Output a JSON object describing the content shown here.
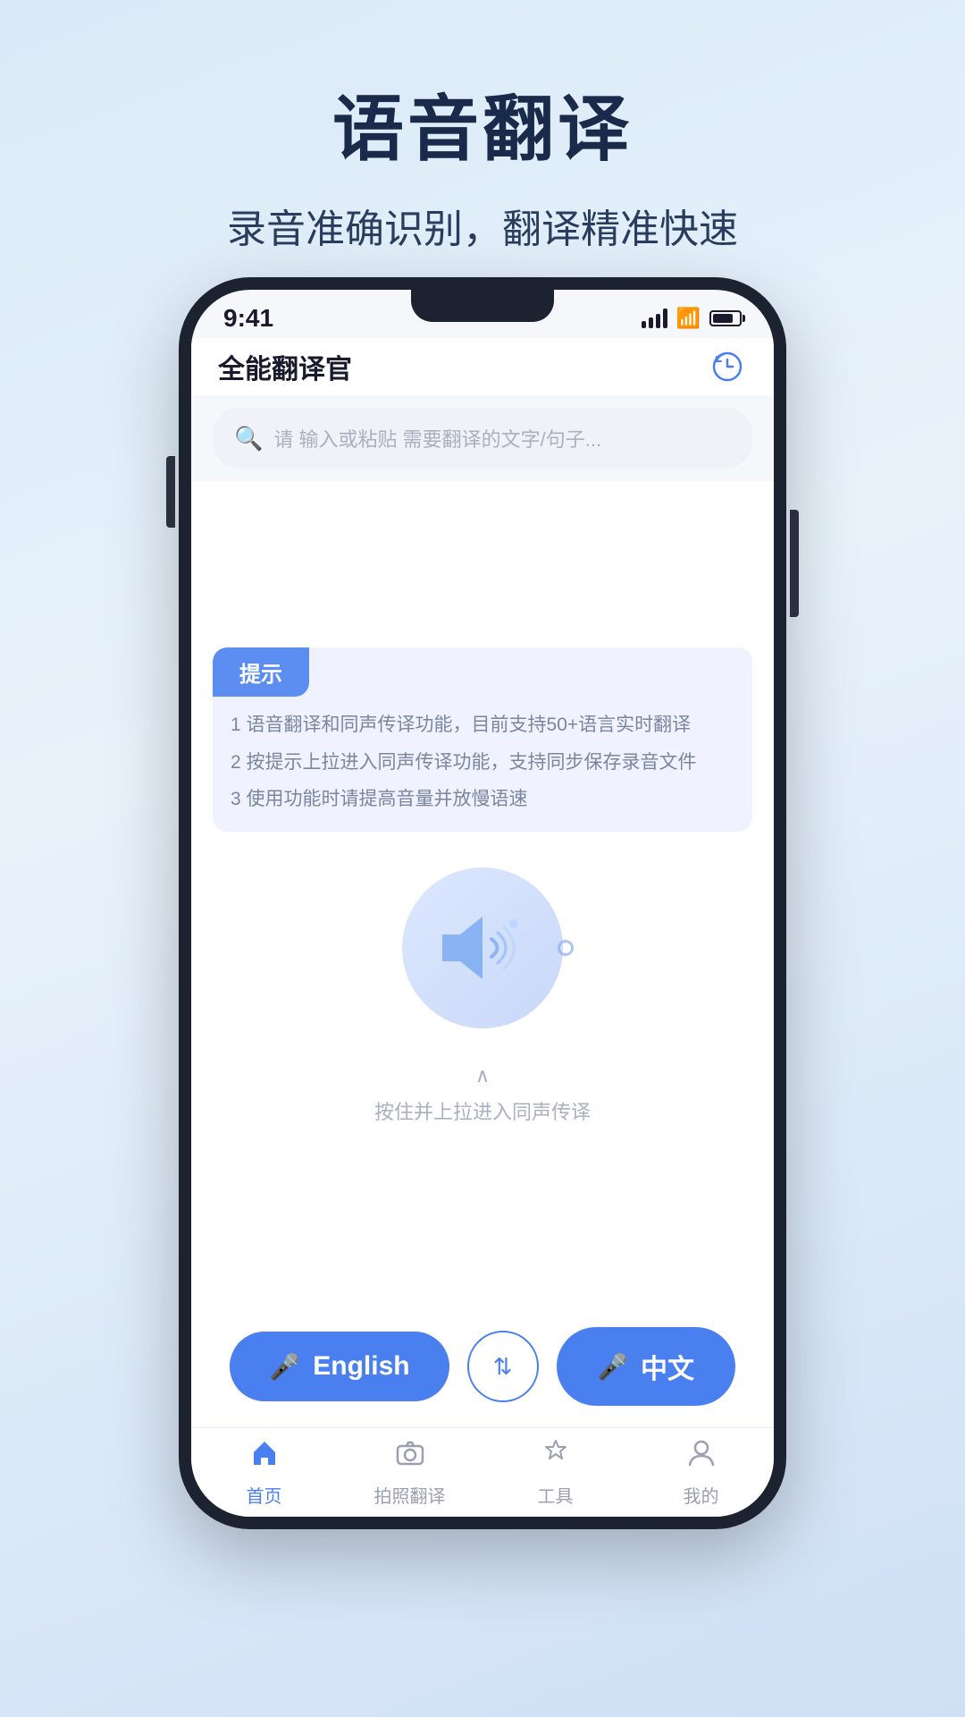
{
  "page": {
    "title": "语音翻译",
    "subtitle": "录音准确识别，翻译精准快速"
  },
  "status_bar": {
    "time": "9:41",
    "signal": "signal",
    "wifi": "wifi",
    "battery": "battery"
  },
  "app_bar": {
    "title": "全能翻译官",
    "history_label": "history"
  },
  "search": {
    "placeholder": "请 输入或粘贴 需要翻译的文字/句子..."
  },
  "tips": {
    "header": "提示",
    "items": [
      "1 语音翻译和同声传译功能，目前支持50+语言实时翻译",
      "2 按提示上拉进入同声传译功能，支持同步保存录音文件",
      "3 使用功能时请提高音量并放慢语速"
    ]
  },
  "swipe_hint": {
    "text": "按住并上拉进入同声传译"
  },
  "buttons": {
    "left_label": "English",
    "right_label": "中文",
    "swap_label": "swap"
  },
  "nav": {
    "items": [
      {
        "id": "home",
        "label": "首页",
        "active": true
      },
      {
        "id": "photo",
        "label": "拍照翻译",
        "active": false
      },
      {
        "id": "tools",
        "label": "工具",
        "active": false
      },
      {
        "id": "mine",
        "label": "我的",
        "active": false
      }
    ]
  },
  "colors": {
    "accent": "#4a7ff0",
    "text_dark": "#1a2a4a",
    "text_sub": "#2a3d5e",
    "tip_bg": "#5b8ef0"
  }
}
